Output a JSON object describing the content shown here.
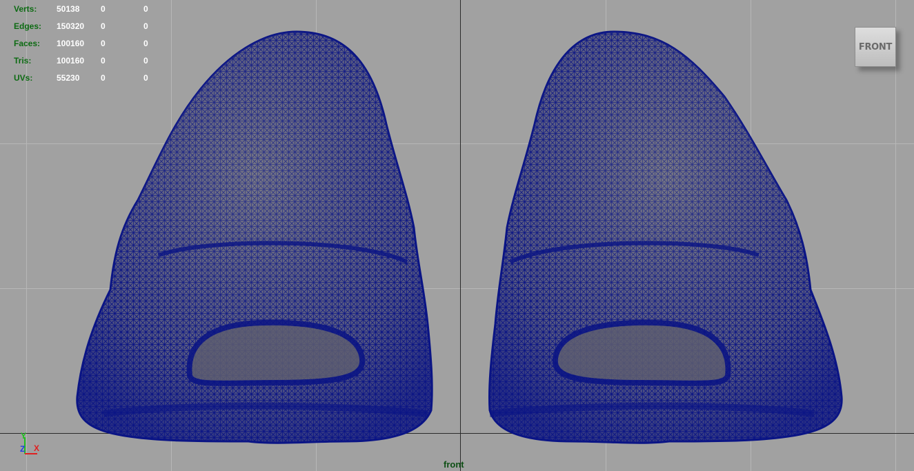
{
  "hud": {
    "rows": [
      {
        "label": "Verts:",
        "v1": "50138",
        "v2": "0",
        "v3": "0"
      },
      {
        "label": "Edges:",
        "v1": "150320",
        "v2": "0",
        "v3": "0"
      },
      {
        "label": "Faces:",
        "v1": "100160",
        "v2": "0",
        "v3": "0"
      },
      {
        "label": "Tris:",
        "v1": "100160",
        "v2": "0",
        "v3": "0"
      },
      {
        "label": "UVs:",
        "v1": "55230",
        "v2": "0",
        "v3": "0"
      }
    ]
  },
  "viewcube": {
    "label": "FRONT"
  },
  "camera": {
    "label": "front"
  },
  "axes": {
    "y": "Y",
    "z": "Z",
    "x": "X"
  },
  "colors": {
    "viewport_bg": "#a1a1a1",
    "wireframe": "#0a1485",
    "hud_label": "#0d6b13",
    "hud_value": "#ffffff",
    "axis_x": "#e02020",
    "axis_y": "#20c020",
    "axis_z": "#2040e0"
  }
}
